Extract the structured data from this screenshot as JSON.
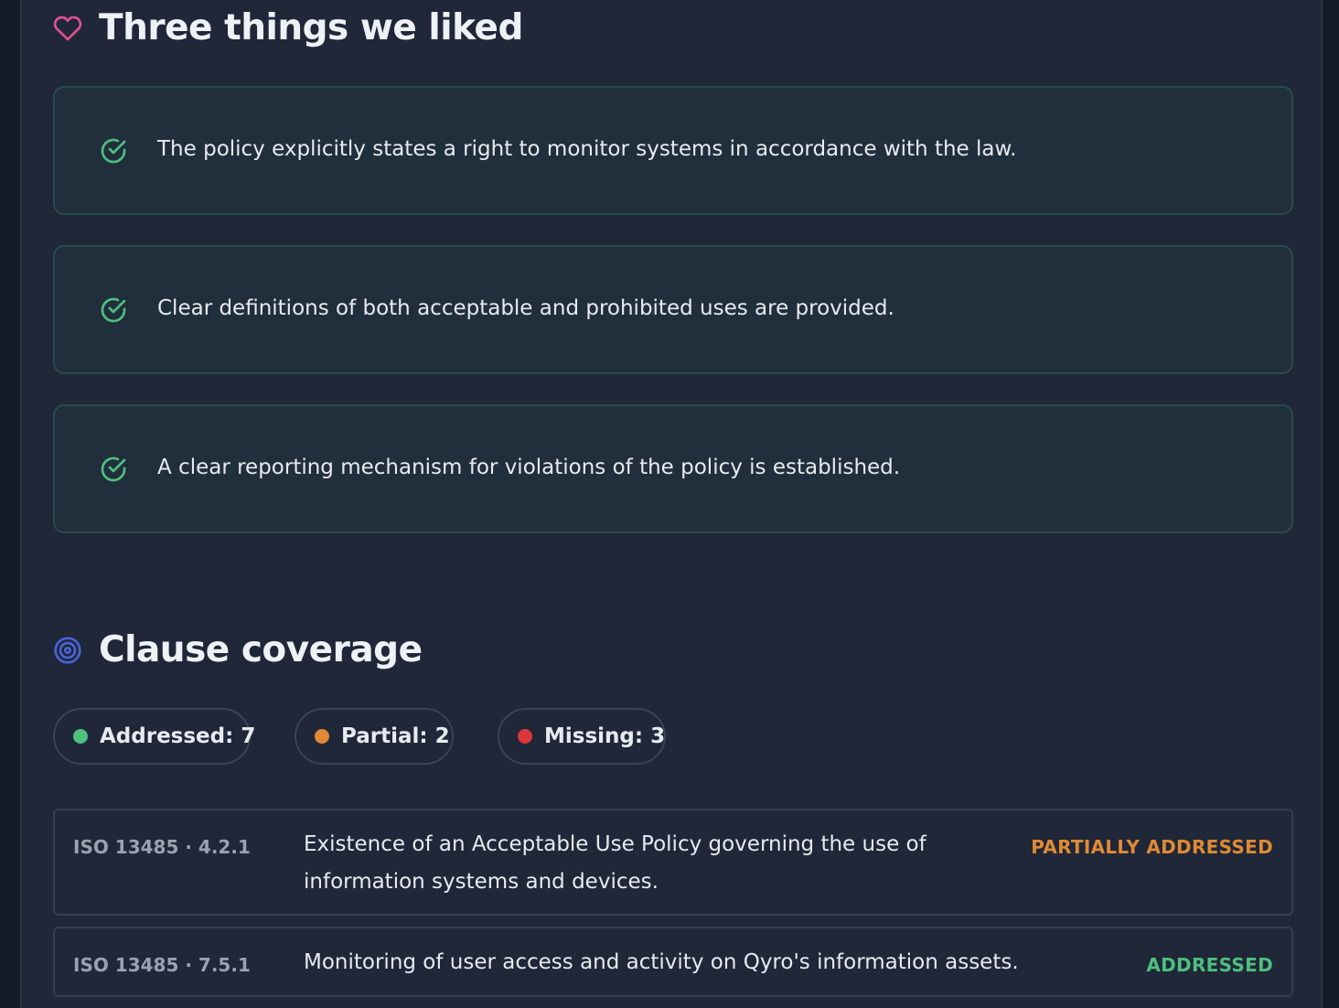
{
  "liked": {
    "title": "Three things we liked",
    "items": [
      {
        "text": "The policy explicitly states a right to monitor systems in accordance with the law."
      },
      {
        "text": "Clear definitions of both acceptable and prohibited uses are provided."
      },
      {
        "text": "A clear reporting mechanism for violations of the policy is established."
      }
    ]
  },
  "coverage": {
    "title": "Clause coverage",
    "summary": [
      {
        "label": "Addressed: 7",
        "color": "#4fbf7e"
      },
      {
        "label": "Partial: 2",
        "color": "#e08a34"
      },
      {
        "label": "Missing: 3",
        "color": "#d9363a"
      }
    ],
    "clauses": [
      {
        "ref": "ISO 13485 · 4.2.1",
        "description": "Existence of an Acceptable Use Policy governing the use of information systems and devices.",
        "status": "PARTIALLY ADDRESSED",
        "status_color": "#e08a34"
      },
      {
        "ref": "ISO 13485 · 7.5.1",
        "description": "Monitoring of user access and activity on Qyro's information assets.",
        "status": "ADDRESSED",
        "status_color": "#4fbf7e"
      }
    ]
  },
  "icons": {
    "liked": "heart-icon",
    "item": "check-circle-icon",
    "coverage": "target-icon"
  },
  "colors": {
    "heart": "#e0508f",
    "check": "#4fbf7e",
    "target": "#4a63d8"
  }
}
